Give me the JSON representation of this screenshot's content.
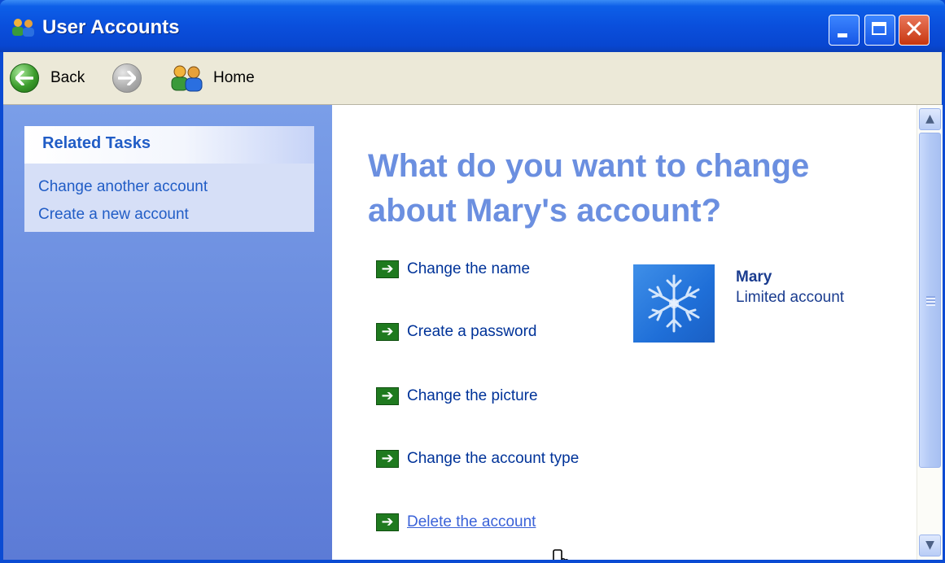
{
  "window": {
    "title": "User Accounts",
    "icon": "user-accounts-icon"
  },
  "title_buttons": {
    "minimize": "minimize-icon",
    "maximize": "maximize-icon",
    "close": "close-icon",
    "close_glyph": "✕"
  },
  "toolbar": {
    "back_label": "Back",
    "forward_icon": "forward-arrow-icon",
    "home_label": "Home"
  },
  "related_tasks": {
    "title": "Related Tasks",
    "items": [
      {
        "label": "Change another account"
      },
      {
        "label": "Create a new account"
      }
    ]
  },
  "main": {
    "heading_line1": "What do you want to change",
    "heading_line2": "about Mary's account?",
    "actions": [
      {
        "label": "Change the name"
      },
      {
        "label": "Create a password"
      },
      {
        "label": "Change the picture"
      },
      {
        "label": "Change the account type"
      },
      {
        "label": "Delete the account"
      }
    ],
    "arrow_glyph": "➔"
  },
  "user": {
    "name": "Mary",
    "account_type": "Limited account",
    "picture": "snowflake-picture"
  },
  "scrollbar": {
    "up_glyph": "▲",
    "down_glyph": "▼"
  },
  "colors": {
    "title_bar": "#0a4fdc",
    "link_blue": "#215dc6",
    "heading_blue": "#6b8fe0",
    "arrow_green": "#1f7a1f"
  }
}
